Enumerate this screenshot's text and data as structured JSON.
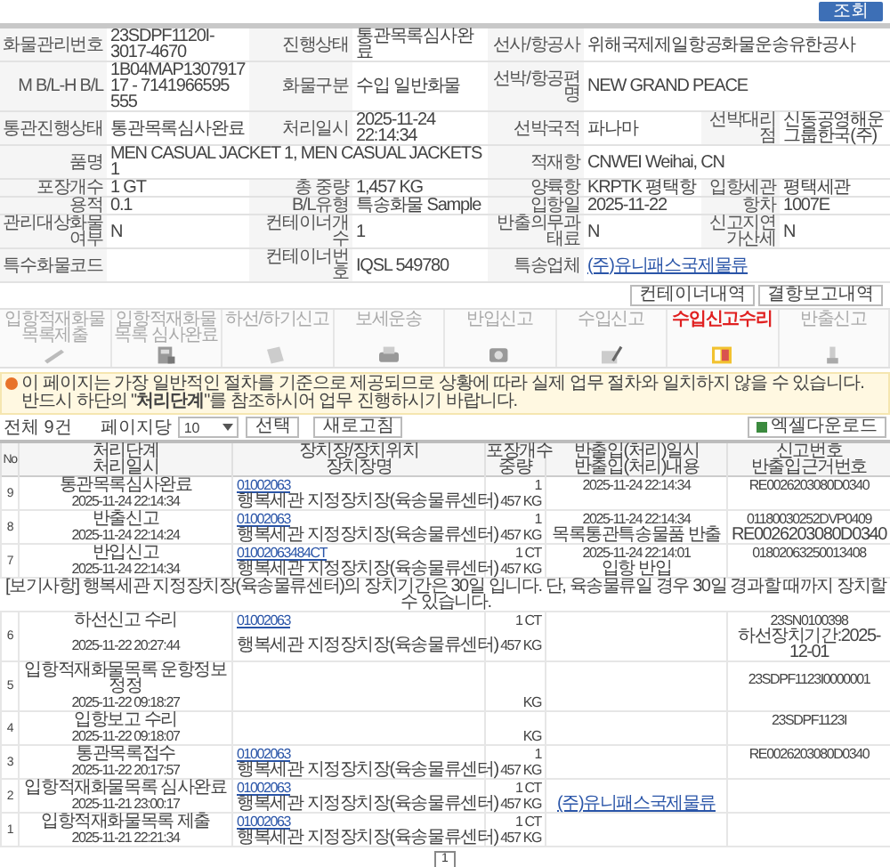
{
  "search_button": "조회",
  "summary": [
    [
      {
        "label": "화물관리번호",
        "value": "23SDPF1120I-3017-4670",
        "kind": "text"
      },
      {
        "label": "진행상태",
        "value": "통관목록심사완료",
        "kind": "text"
      },
      {
        "label": "선사/항공사",
        "value": "위해국제제일항공화물운송유한공사",
        "kind": "text"
      }
    ],
    [
      {
        "label": "M B/L-H B/L",
        "value": "1B04MAP130791717 - 7141966595 555",
        "kind": "text"
      },
      {
        "label": "화물구분",
        "value": "수입 일반화물",
        "kind": "text"
      },
      {
        "label": "선박/항공편명",
        "value": "NEW GRAND PEACE",
        "kind": "text"
      }
    ],
    [
      {
        "label": "통관진행상태",
        "value": "통관목록심사완료",
        "kind": "text"
      },
      {
        "label": "처리일시",
        "value": "2025-11-24 22:14:34",
        "kind": "text"
      },
      {
        "label": "선박국적",
        "value": "파나마",
        "kind": "text"
      },
      {
        "label": "선박대리점",
        "value": "신동공영해운그룹한국(주)",
        "kind": "text"
      }
    ],
    [
      {
        "label": "품명",
        "value": "MEN CASUAL JACKET 1, MEN CASUAL JACKETS 1",
        "kind": "text"
      },
      {
        "label": "적재항",
        "value": "CNWEI Weihai, CN",
        "kind": "text"
      }
    ],
    [
      {
        "label": "포장개수",
        "value": "1 GT",
        "kind": "text"
      },
      {
        "label": "총 중량",
        "value": "1,457 KG",
        "kind": "text"
      },
      {
        "label": "양륙항",
        "value": "KRPTK 평택항",
        "kind": "text"
      },
      {
        "label": "입항세관",
        "value": "평택세관",
        "kind": "text"
      }
    ],
    [
      {
        "label": "용적",
        "value": "0.1",
        "kind": "text"
      },
      {
        "label": "B/L유형",
        "value": "특송화물 Sample",
        "kind": "text"
      },
      {
        "label": "입항일",
        "value": "2025-11-22",
        "kind": "text"
      },
      {
        "label": "항차",
        "value": "1007E",
        "kind": "text"
      }
    ],
    [
      {
        "label": "관리대상화물여부",
        "value": "N",
        "kind": "text"
      },
      {
        "label": "컨테이너개수",
        "value": "1",
        "kind": "text"
      },
      {
        "label": "반출의무과태료",
        "value": "N",
        "kind": "text"
      },
      {
        "label": "신고지연가산세",
        "value": "N",
        "kind": "text"
      }
    ],
    [
      {
        "label": "특수화물코드"
      },
      {
        "label": "컨테이너번호",
        "value": "IQSL 549780",
        "kind": "text"
      },
      {
        "label": "특송업체",
        "value": "(주)유니패스국제물류",
        "kind": "link"
      }
    ]
  ],
  "detail_buttons": [
    "컨테이너내역",
    "결항보고내역"
  ],
  "steps": [
    {
      "label": "입항적재화물목록제출",
      "selected": false
    },
    {
      "label": "입항적재화물목록 심사완료",
      "selected": false
    },
    {
      "label": "하선/하기신고",
      "selected": false
    },
    {
      "label": "보세운송",
      "selected": false
    },
    {
      "label": "반입신고",
      "selected": false
    },
    {
      "label": "수입신고",
      "selected": false
    },
    {
      "label": "수입신고수리",
      "selected": true
    },
    {
      "label": "반출신고",
      "selected": false
    }
  ],
  "notice": "이 페이지는 가장 일반적인 절차를 기준으로 제공되므로 상황에 따라 실제 업무 절차와 일치하지 않을 수 있습니다. 반드시 하단의 \"**처리단계**\"를 참조하시어 업무 진행하시기 바랍니다.",
  "controls": {
    "total": "전체 9건",
    "page_size_label": "페이지당",
    "page_size": "10",
    "select_button": "선택",
    "refresh_button": "새로고침",
    "excel_button": "엑셀다운로드"
  },
  "table": {
    "header_top": [
      "No",
      "처리단계",
      "장치장/장치위치",
      "포장개수",
      "반출입(처리)일시",
      "신고번호"
    ],
    "header_bottom": [
      "처리일시",
      "장치장명",
      "중량",
      "반출입(처리)내용",
      "반출입근거번호"
    ],
    "records": [
      {
        "no": "9",
        "step": "통관목록심사완료",
        "code": "01002063",
        "packages": "1",
        "inout_time": "2025-11-24 22:14:34",
        "report_no": "RE0026203080D0340",
        "time": "2025-11-24 22:14:34",
        "warehouse": "행복세관 지정장치장(육송물류센터)",
        "weight": "457 KG"
      },
      {
        "no": "8",
        "step": "반출신고",
        "code": "01002063",
        "packages": "1",
        "inout_time": "2025-11-24 22:14:34",
        "report_no": "01180030252DVP0409",
        "time": "2025-11-24 22:14:24",
        "warehouse": "행복세관 지정장치장(육송물류센터)",
        "weight": "457 KG",
        "inout_content": {
          "text": "목록통관특송물품 반출",
          "kind": "text"
        },
        "basis_no": "RE0026203080D0340"
      },
      {
        "no": "7",
        "step": "반입신고",
        "code": "01002063484CT",
        "packages": "1 CT",
        "inout_time": "2025-11-24 22:14:01",
        "report_no": "01802063250013408",
        "time": "2025-11-24 22:14:34",
        "warehouse": "행복세관 지정장치장(육송물류센터)",
        "weight": "457 KG",
        "inout_content": {
          "text": "입항 반입",
          "kind": "text"
        },
        "note": "[보기사항] 행복세관 지정장치장(육송물류센터)의 장치기간은 30일 입니다. 단, 육송물류일 경우 30일 경과할 때까지 장치할 수 있습니다."
      },
      {
        "no": "6",
        "step": "하선신고 수리",
        "code": "01002063",
        "packages": "1 CT",
        "report_no": "23SN0100398",
        "time": "2025-11-22 20:27:44",
        "warehouse": "행복세관 지정장치장(육송물류센터)",
        "weight": "457 KG",
        "basis_no": "하선장치기간:2025-12-01"
      },
      {
        "no": "5",
        "step": "입항적재화물목록 운항정보 정정",
        "report_no": "23SDPF1123I0000001",
        "time": "2025-11-22 09:18:27",
        "weight": "KG"
      },
      {
        "no": "4",
        "step": "입항보고 수리",
        "report_no": "23SDPF1123I",
        "time": "2025-11-22 09:18:07",
        "weight": "KG"
      },
      {
        "no": "3",
        "step": "통관목록접수",
        "code": "01002063",
        "packages": "1",
        "report_no": "RE0026203080D0340",
        "time": "2025-11-22 20:17:57",
        "warehouse": "행복세관 지정장치장(육송물류센터)",
        "weight": "457 KG"
      },
      {
        "no": "2",
        "step": "입항적재화물목록 심사완료",
        "code": "01002063",
        "packages": "1 CT",
        "time": "2025-11-21 23:00:17",
        "warehouse": "행복세관 지정장치장(육송물류센터)",
        "weight": "457 KG",
        "inout_content": {
          "text": "(주)유니패스국제물류",
          "kind": "link"
        }
      },
      {
        "no": "1",
        "step": "입항적재화물목록 제출",
        "code": "01002063",
        "packages": "1 CT",
        "time": "2025-11-21 22:21:34",
        "warehouse": "행복세관 지정장치장(육송물류센터)",
        "weight": "457 KG"
      }
    ]
  },
  "pages": [
    {
      "label": "1",
      "selected": true
    }
  ]
}
